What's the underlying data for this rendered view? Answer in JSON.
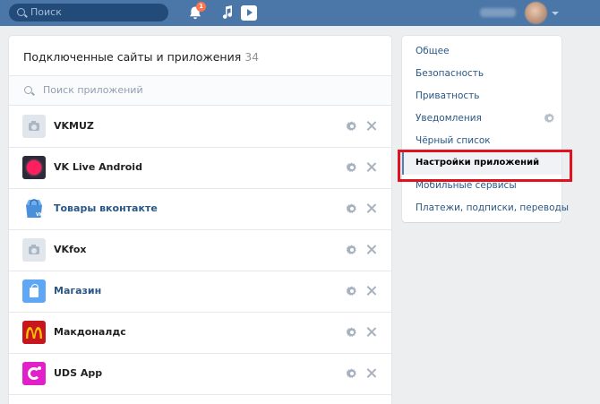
{
  "header": {
    "search_placeholder": "Поиск",
    "notifications_badge": "1",
    "colors": {
      "bar": "#4a76a8",
      "badge": "#ff734c"
    },
    "icons": [
      "search-icon",
      "bell-icon",
      "music-note-icon",
      "video-play-icon",
      "avatar",
      "chevron-down-icon"
    ]
  },
  "main": {
    "title": "Подключенные сайты и приложения",
    "count": "34",
    "app_search_placeholder": "Поиск приложений",
    "apps": [
      {
        "name": "VKMUZ",
        "icon": "camera-placeholder-icon"
      },
      {
        "name": "VK Live Android",
        "icon": "vk-live-icon"
      },
      {
        "name": "Товары вконтакте",
        "icon": "vk-shop-bag-icon"
      },
      {
        "name": "VKfox",
        "icon": "camera-placeholder-icon"
      },
      {
        "name": "Магазин",
        "icon": "shopping-bag-icon"
      },
      {
        "name": "Макдоналдс",
        "icon": "mcdonalds-logo-icon"
      },
      {
        "name": "UDS App",
        "icon": "uds-logo-icon"
      }
    ]
  },
  "menu": {
    "items": [
      {
        "label": "Общее"
      },
      {
        "label": "Безопасность"
      },
      {
        "label": "Приватность"
      },
      {
        "label": "Уведомления"
      },
      {
        "label": "Чёрный список"
      },
      {
        "label": "Настройки приложений",
        "active": true
      },
      {
        "label": "Мобильные сервисы"
      },
      {
        "label": "Платежи, подписки, переводы"
      }
    ],
    "highlight_color": "#e3111d"
  }
}
